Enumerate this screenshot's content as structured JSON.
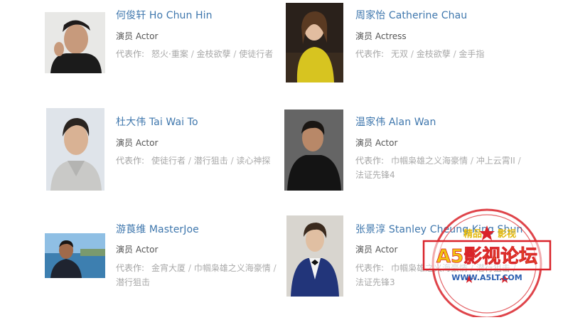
{
  "labels": {
    "works_prefix": "代表作:",
    "separator": " / "
  },
  "actors": [
    {
      "name": "何俊轩 Ho Chun Hin",
      "role": "演员 Actor",
      "works": [
        "怒火·重案",
        "金枝欲孽",
        "使徒行者"
      ]
    },
    {
      "name": "周家怡 Catherine Chau",
      "role": "演员 Actress",
      "works": [
        "无双",
        "金枝欲孽",
        "金手指"
      ]
    },
    {
      "name": "杜大伟 Tai Wai To",
      "role": "演员 Actor",
      "works": [
        "使徒行者",
        "潜行狙击",
        "读心神探"
      ]
    },
    {
      "name": "温家伟 Alan Wan",
      "role": "演员 Actor",
      "works": [
        "巾帼枭雄之义海豪情",
        "冲上云霄II",
        "法证先锋4"
      ]
    },
    {
      "name": "游莨维 MasterJoe",
      "role": "演员 Actor",
      "works": [
        "金宵大厦",
        "巾帼枭雄之义海豪情",
        "潜行狙击"
      ]
    },
    {
      "name": "张景淳 Stanley Cheung King Shun",
      "role": "演员 Actor",
      "works": [
        "巾帼枭雄之义海豪情",
        "潜行狙击",
        "法证先锋3"
      ]
    }
  ],
  "watermark": {
    "top_text": "精品",
    "top_text_right": "影视",
    "title": "A5影视论坛",
    "url": "WWW.A5LT.COM",
    "color": "#d9232a",
    "accent": "#f1c40f"
  }
}
